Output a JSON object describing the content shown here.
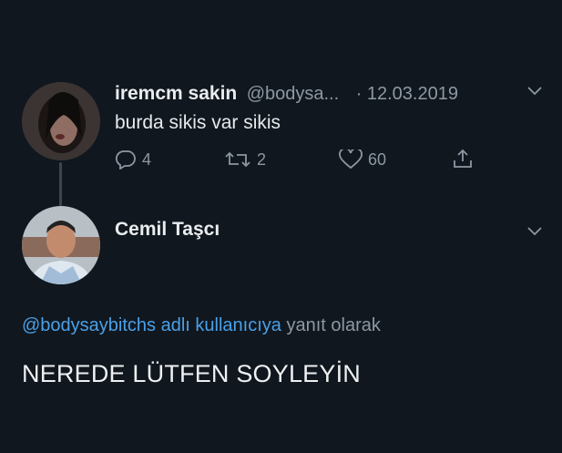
{
  "tweet": {
    "display_name": "iremcm sakin",
    "handle": "@bodysa...",
    "date": "· 12.03.2019",
    "text": "burda sikis var sikis",
    "actions": {
      "reply_count": "4",
      "retweet_count": "2",
      "like_count": "60"
    }
  },
  "reply": {
    "display_name": "Cemil Taşcı",
    "replying_to_mention": "@bodysaybitchs adlı kullanıcıya",
    "replying_to_suffix": "yanıt olarak",
    "text": "NEREDE LÜTFEN SOYLEYİN"
  },
  "colors": {
    "background": "#10171e",
    "link": "#4aa0e8",
    "muted": "#8d98a3"
  },
  "icons": [
    "reply-icon",
    "retweet-icon",
    "like-icon",
    "share-icon",
    "chevron-down-icon"
  ]
}
